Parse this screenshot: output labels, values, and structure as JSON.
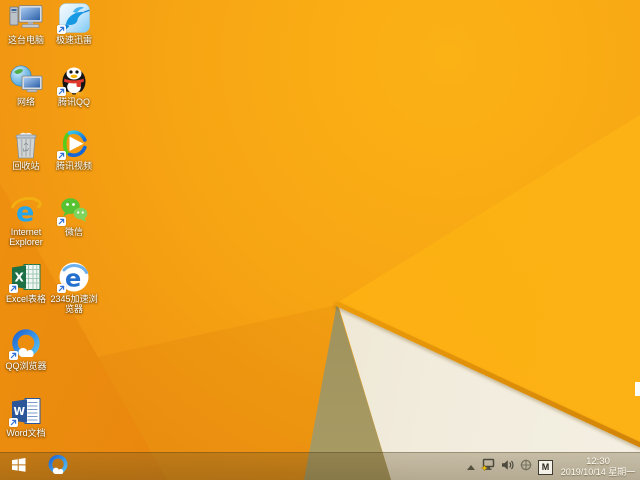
{
  "desktop": {
    "icons": [
      {
        "name": "this-pc",
        "label": "这台电脑",
        "shortcut": false
      },
      {
        "name": "thunder-speed",
        "label": "极速迅雷",
        "shortcut": true
      },
      {
        "name": "network",
        "label": "网络",
        "shortcut": false
      },
      {
        "name": "tencent-qq",
        "label": "腾讯QQ",
        "shortcut": true
      },
      {
        "name": "recycle-bin",
        "label": "回收站",
        "shortcut": false
      },
      {
        "name": "tencent-video",
        "label": "腾讯视频",
        "shortcut": true
      },
      {
        "name": "internet-explorer",
        "label": "Internet Explorer",
        "shortcut": false
      },
      {
        "name": "wechat",
        "label": "微信",
        "shortcut": true
      },
      {
        "name": "excel",
        "label": "Excel表格",
        "shortcut": true
      },
      {
        "name": "2345-browser",
        "label": "2345加速浏览器",
        "shortcut": true
      },
      {
        "name": "qq-browser",
        "label": "QQ浏览器",
        "shortcut": true
      },
      {
        "name": "word",
        "label": "Word文档",
        "shortcut": true
      }
    ]
  },
  "wallpaper": {
    "base_orange": "#F7A513",
    "bright_facet": "#FCB214",
    "dark_corner": "#E3820B",
    "cream_facet": "#F2ECDD",
    "olive_shadow": "#A2945C",
    "ridge_line": "#D98F08"
  },
  "taskbar": {
    "pinned_icons": [
      "start",
      "qq-browser"
    ],
    "tray_icons": [
      "show-hidden-icons",
      "network-warning",
      "volume",
      "tray-utility",
      "ime-mode"
    ],
    "ime_mode_label": "M",
    "clock": {
      "time": "12:30",
      "date": "2019/10/14 星期一"
    }
  }
}
